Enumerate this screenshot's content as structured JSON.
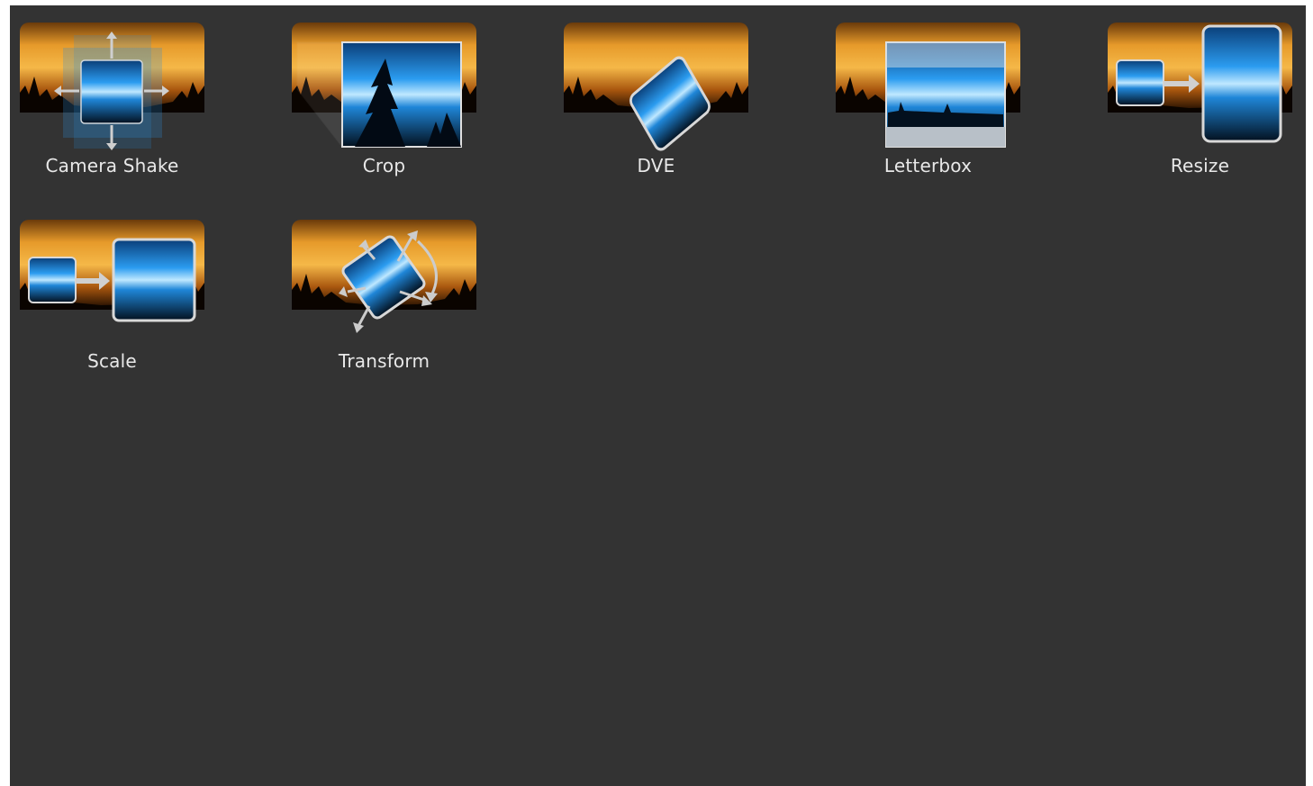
{
  "effects": [
    {
      "label": "Camera Shake",
      "icon": "camera-shake-icon"
    },
    {
      "label": "Crop",
      "icon": "crop-icon"
    },
    {
      "label": "DVE",
      "icon": "dve-icon"
    },
    {
      "label": "Letterbox",
      "icon": "letterbox-icon"
    },
    {
      "label": "Resize",
      "icon": "resize-icon"
    },
    {
      "label": "Scale",
      "icon": "scale-icon"
    },
    {
      "label": "Transform",
      "icon": "transform-icon"
    }
  ],
  "colors": {
    "background": "#333333",
    "sunset_orange": "#e08a1e",
    "sky_blue": "#1a8fe8",
    "label_text": "#e8e8e8"
  }
}
